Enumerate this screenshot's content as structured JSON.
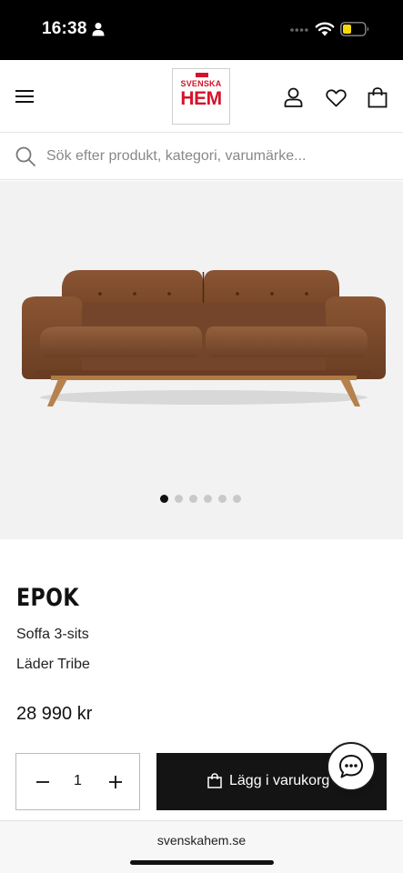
{
  "status_bar": {
    "time": "16:38"
  },
  "header": {
    "logo_top": "SVENSKA",
    "logo_main": "HEM",
    "brand_color": "#d4132a"
  },
  "search": {
    "placeholder": "Sök efter produkt, kategori, varumärke..."
  },
  "gallery": {
    "slide_count": 6,
    "active_slide": 1
  },
  "product": {
    "name": "EPOK",
    "type": "Soffa 3-sits",
    "material": "Läder Tribe",
    "price": "28 990 kr"
  },
  "purchase": {
    "quantity": "1",
    "add_to_cart_label": "Lägg i varukorg"
  },
  "browser": {
    "url": "svenskahem.se"
  },
  "icons": {
    "menu": "hamburger-icon",
    "user": "user-icon",
    "wishlist": "heart-icon",
    "cart": "shopping-bag-icon",
    "search": "search-icon",
    "chat": "chat-bubble-icon"
  }
}
